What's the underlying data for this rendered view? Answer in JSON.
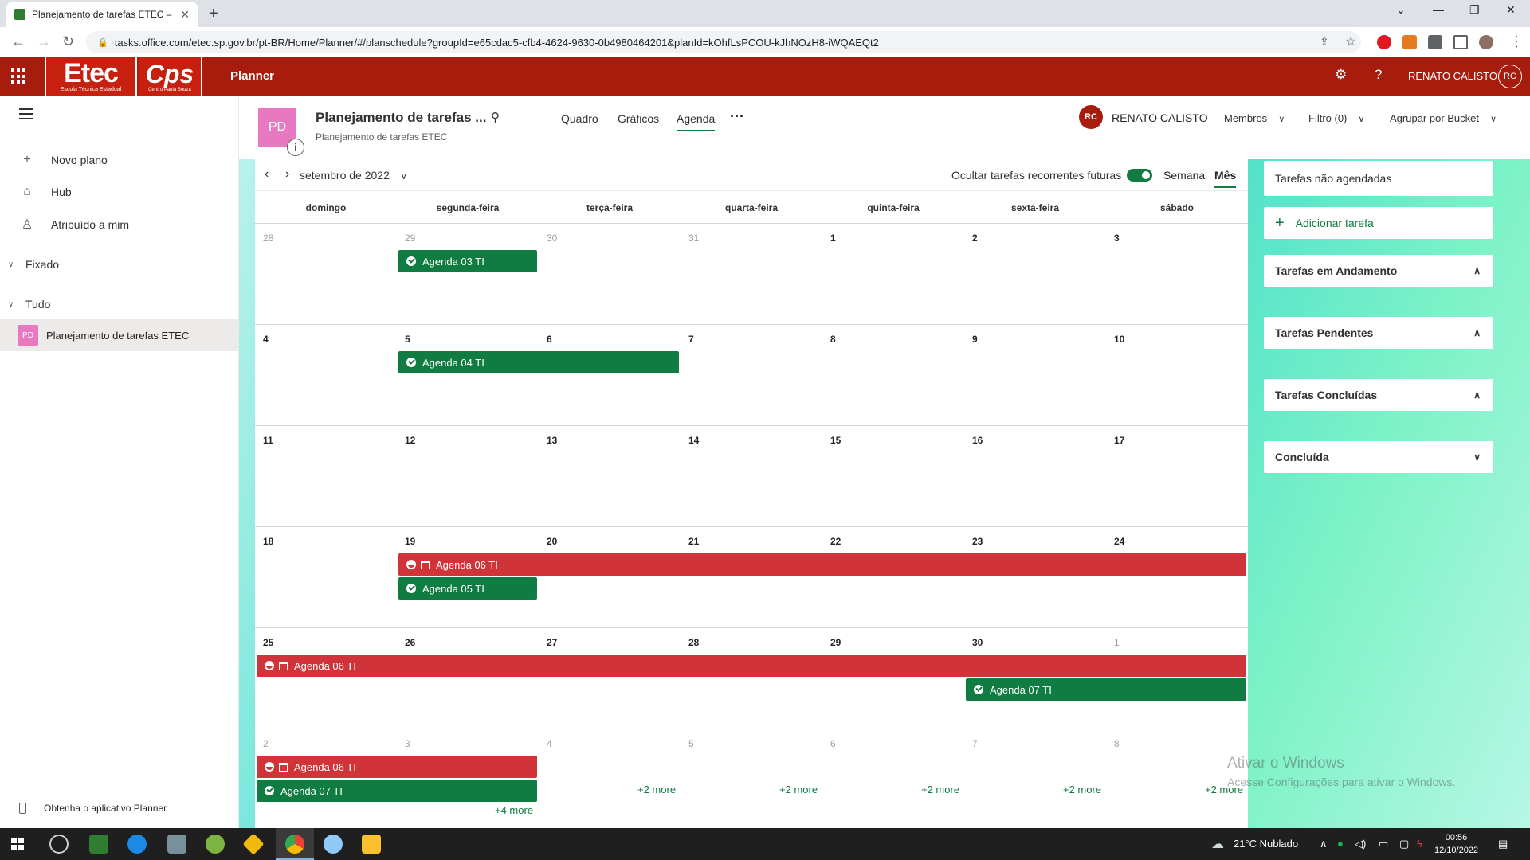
{
  "browser": {
    "tab_title": "Planejamento de tarefas ETEC – P",
    "url": "tasks.office.com/etec.sp.gov.br/pt-BR/Home/Planner/#/planschedule?groupId=e65cdac5-cfb4-4624-9630-0b4980464201&planId=kOhfLsPCOU-kJhNOzH8-iWQAEQt2"
  },
  "header": {
    "logo_etec": "Etec",
    "logo_etec_sub": "Escola Técnica Estadual",
    "logo_cps": "Cps",
    "logo_cps_sub": "Centro Paula Souza",
    "app_name": "Planner",
    "user_name": "RENATO CALISTO",
    "user_initials": "RC"
  },
  "sidebar": {
    "items": [
      {
        "label": "Novo plano",
        "icon": "plus-icon"
      },
      {
        "label": "Hub",
        "icon": "home-icon"
      },
      {
        "label": "Atribuído a mim",
        "icon": "person-icon"
      }
    ],
    "pinned_label": "Fixado",
    "all_label": "Tudo",
    "plan": {
      "initials": "PD",
      "label": "Planejamento de tarefas ETEC"
    },
    "get_app": "Obtenha o aplicativo Planner"
  },
  "plan": {
    "initials": "PD",
    "title": "Planejamento de tarefas ...",
    "subtitle": "Planejamento de tarefas ETEC",
    "tabs": [
      "Quadro",
      "Gráficos",
      "Agenda"
    ],
    "active_tab": "Agenda",
    "member_initials": "RC",
    "member_name": "RENATO CALISTO",
    "members_label": "Membros",
    "filter_label": "Filtro (0)",
    "group_label": "Agrupar por Bucket"
  },
  "calendar": {
    "month": "setembro de 2022",
    "hide_recurring": "Ocultar tarefas recorrentes futuras",
    "hide_recurring_on": true,
    "week_label": "Semana",
    "month_label": "Mês",
    "weekdays": [
      "domingo",
      "segunda-feira",
      "terça-feira",
      "quarta-feira",
      "quinta-feira",
      "sexta-feira",
      "sábado"
    ],
    "weeks": [
      [
        "28",
        "29",
        "30",
        "31",
        "1",
        "2",
        "3"
      ],
      [
        "4",
        "5",
        "6",
        "7",
        "8",
        "9",
        "10"
      ],
      [
        "11",
        "12",
        "13",
        "14",
        "15",
        "16",
        "17"
      ],
      [
        "18",
        "19",
        "20",
        "21",
        "22",
        "23",
        "24"
      ],
      [
        "25",
        "26",
        "27",
        "28",
        "29",
        "30",
        "1"
      ],
      [
        "2",
        "3",
        "4",
        "5",
        "6",
        "7",
        "8"
      ]
    ],
    "events": [
      {
        "label": "Agenda 03 TI",
        "status": "done",
        "color": "#107c41"
      },
      {
        "label": "Agenda 04 TI",
        "status": "done",
        "color": "#107c41"
      },
      {
        "label": "Agenda 06 TI",
        "status": "in-progress",
        "color": "#d13438"
      },
      {
        "label": "Agenda 05 TI",
        "status": "done",
        "color": "#107c41"
      },
      {
        "label": "Agenda 06 TI",
        "status": "in-progress",
        "color": "#d13438"
      },
      {
        "label": "Agenda 07 TI",
        "status": "done",
        "color": "#107c41"
      },
      {
        "label": "Agenda 06 TI",
        "status": "in-progress",
        "color": "#d13438"
      },
      {
        "label": "Agenda 07 TI",
        "status": "done",
        "color": "#107c41"
      }
    ],
    "more_links": [
      "+4 more",
      "+2 more",
      "+2 more",
      "+2 more",
      "+2 more",
      "+2 more"
    ]
  },
  "right_panel": {
    "unscheduled": "Tarefas não agendadas",
    "add_task": "Adicionar tarefa",
    "buckets": [
      {
        "label": "Tarefas em Andamento",
        "expanded": true
      },
      {
        "label": "Tarefas Pendentes",
        "expanded": true
      },
      {
        "label": "Tarefas Concluídas",
        "expanded": true
      },
      {
        "label": "Concluída",
        "expanded": false
      }
    ]
  },
  "watermark": {
    "line1": "Ativar o Windows",
    "line2": "Acesse Configurações para ativar o Windows."
  },
  "taskbar": {
    "weather": "21°C  Nublado",
    "time": "00:56",
    "date": "12/10/2022"
  }
}
